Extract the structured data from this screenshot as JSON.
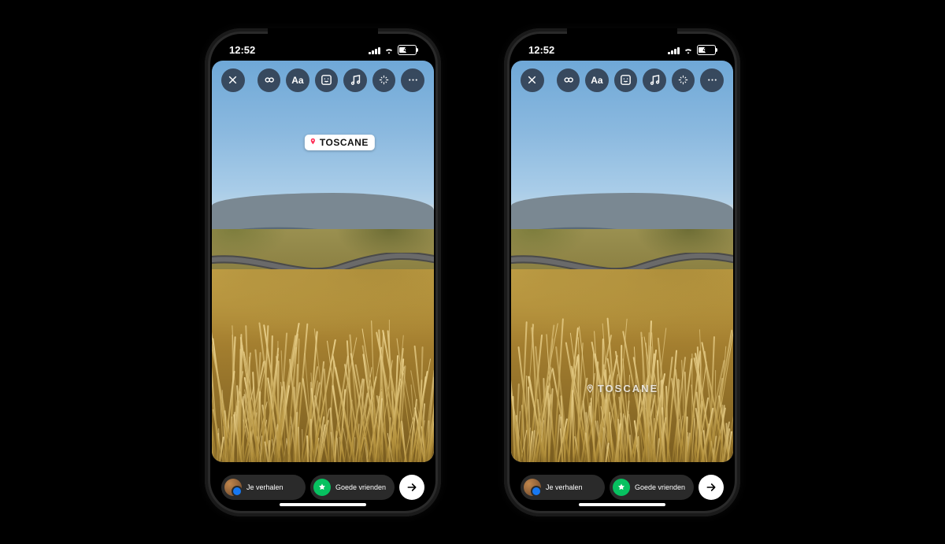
{
  "statusBar": {
    "time": "12:52",
    "batteryText": "41",
    "batteryPercent": 41
  },
  "toolbar": {
    "close": "close",
    "boomerang": "boomerang",
    "text": "Aa",
    "sticker": "sticker",
    "music": "music",
    "effects": "effects",
    "more": "more"
  },
  "locationSticker": {
    "label": "TOSCANE"
  },
  "shareBar": {
    "yourStory": "Je verhalen",
    "closeFriends": "Goede vrienden"
  }
}
